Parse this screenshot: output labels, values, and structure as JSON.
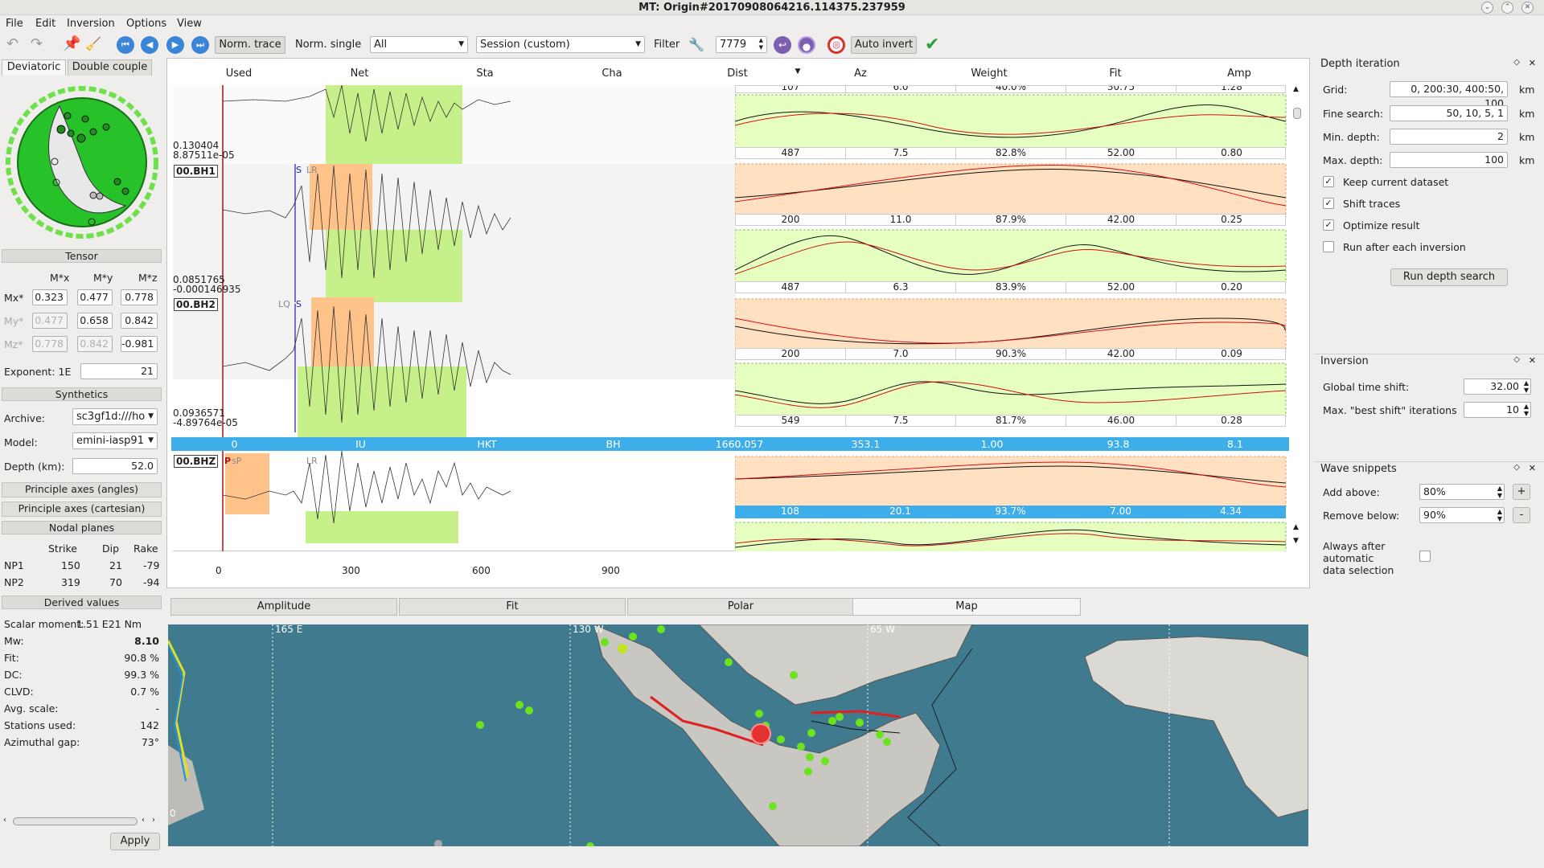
{
  "window": {
    "title": "MT: Origin#20170908064216.114375.237959"
  },
  "menu": [
    "File",
    "Edit",
    "Inversion",
    "Options",
    "View"
  ],
  "toolbar": {
    "norm_trace": "Norm. trace",
    "norm_single": "Norm. single",
    "component_select": "All",
    "session_select": "Session (custom)",
    "filter_label": "Filter",
    "filter_value": "7779",
    "auto_invert": "Auto invert"
  },
  "left": {
    "tabs": [
      "Deviatoric",
      "Double couple"
    ],
    "tensor": {
      "header": "Tensor",
      "col_headers": [
        "M*x",
        "M*y",
        "M*z"
      ],
      "row_labels": [
        "Mx*",
        "My*",
        "Mz*"
      ],
      "rows": [
        [
          "0.323",
          "0.477",
          "0.778"
        ],
        [
          "0.477",
          "0.658",
          "0.842"
        ],
        [
          "0.778",
          "0.842",
          "-0.981"
        ]
      ],
      "exponent_label": "Exponent: 1E",
      "exponent": "21"
    },
    "synthetics": {
      "header": "Synthetics",
      "archive_label": "Archive:",
      "archive": "sc3gf1d:///ho",
      "model_label": "Model:",
      "model": "emini-iasp91",
      "depth_label": "Depth (km):",
      "depth": "52.0"
    },
    "principle_angles": "Principle axes (angles)",
    "principle_cart": "Principle axes (cartesian)",
    "nodal": {
      "header": "Nodal planes",
      "cols": [
        "Strike",
        "Dip",
        "Rake"
      ],
      "rows": [
        [
          "NP1",
          "150",
          "21",
          "-79"
        ],
        [
          "NP2",
          "319",
          "70",
          "-94"
        ]
      ]
    },
    "derived": {
      "header": "Derived values",
      "items": [
        [
          "Scalar moment:",
          "1.51 E21 Nm"
        ],
        [
          "Mw:",
          "8.10"
        ],
        [
          "Fit:",
          "90.8 %"
        ],
        [
          "DC:",
          "99.3 %"
        ],
        [
          "CLVD:",
          "0.7 %"
        ],
        [
          "Avg. scale:",
          "-"
        ],
        [
          "Stations used:",
          "142"
        ],
        [
          "Azimuthal gap:",
          "73°"
        ]
      ]
    },
    "apply": "Apply"
  },
  "table": {
    "headers": [
      "Used",
      "Net",
      "Sta",
      "Cha",
      "Dist",
      "Az",
      "Weight",
      "Fit",
      "Amp"
    ],
    "selected_row": [
      "0",
      "IU",
      "HKT",
      "BH",
      "1660.057",
      "353.1",
      "1.00",
      "93.8",
      "8.1"
    ],
    "traces": [
      {
        "label": "",
        "amp1": "0.130404",
        "amp2": "8.87511e-05"
      },
      {
        "label": "00.BH1",
        "amp1": "0.0851765",
        "amp2": "-0.000146935"
      },
      {
        "label": "00.BH2",
        "amp1": "0.0936571",
        "amp2": "-4.89764e-05"
      },
      {
        "label": "00.BHZ",
        "amp1": "",
        "amp2": ""
      }
    ],
    "snippet_rows": [
      [
        "107",
        "6.0",
        "40.0%",
        "30.75",
        "1.28"
      ],
      [
        "487",
        "7.5",
        "82.8%",
        "52.00",
        "0.80"
      ],
      [
        "200",
        "11.0",
        "87.9%",
        "42.00",
        "0.25"
      ],
      [
        "487",
        "6.3",
        "83.9%",
        "52.00",
        "0.20"
      ],
      [
        "200",
        "7.0",
        "90.3%",
        "42.00",
        "0.09"
      ],
      [
        "549",
        "7.5",
        "81.7%",
        "46.00",
        "0.28"
      ],
      [
        "108",
        "20.1",
        "93.7%",
        "7.00",
        "4.34"
      ]
    ],
    "phase_marks": {
      "s": "S",
      "lr": "LR",
      "lq": "LQ",
      "p": "P",
      "sp": "sP"
    },
    "time_axis": [
      "0",
      "300",
      "600",
      "900"
    ]
  },
  "depth_iteration": {
    "title": "Depth iteration",
    "grid_label": "Grid:",
    "grid": "0, 200:30, 400:50, 100",
    "fine_label": "Fine search:",
    "fine": "50, 10, 5, 1",
    "min_label": "Min. depth:",
    "min": "2",
    "max_label": "Max. depth:",
    "max": "100",
    "unit": "km",
    "checks": [
      {
        "label": "Keep current dataset",
        "on": true
      },
      {
        "label": "Shift traces",
        "on": true
      },
      {
        "label": "Optimize result",
        "on": true
      },
      {
        "label": "Run after each inversion",
        "on": false
      }
    ],
    "run": "Run depth search"
  },
  "inversion": {
    "title": "Inversion",
    "shift_label": "Global time shift:",
    "shift": "32.00",
    "iter_label": "Max. \"best shift\" iterations",
    "iter": "10"
  },
  "wave_snippets": {
    "title": "Wave snippets",
    "add_label": "Add above:",
    "add": "80%",
    "remove_label": "Remove below:",
    "remove": "90%",
    "always_label": "Always after automatic data selection",
    "plus": "+",
    "minus": "-"
  },
  "bottom_tabs": [
    "Amplitude",
    "Fit",
    "Polar",
    "Map"
  ],
  "map": {
    "labels": [
      "165 E",
      "130 W",
      "65 W",
      "0"
    ]
  }
}
